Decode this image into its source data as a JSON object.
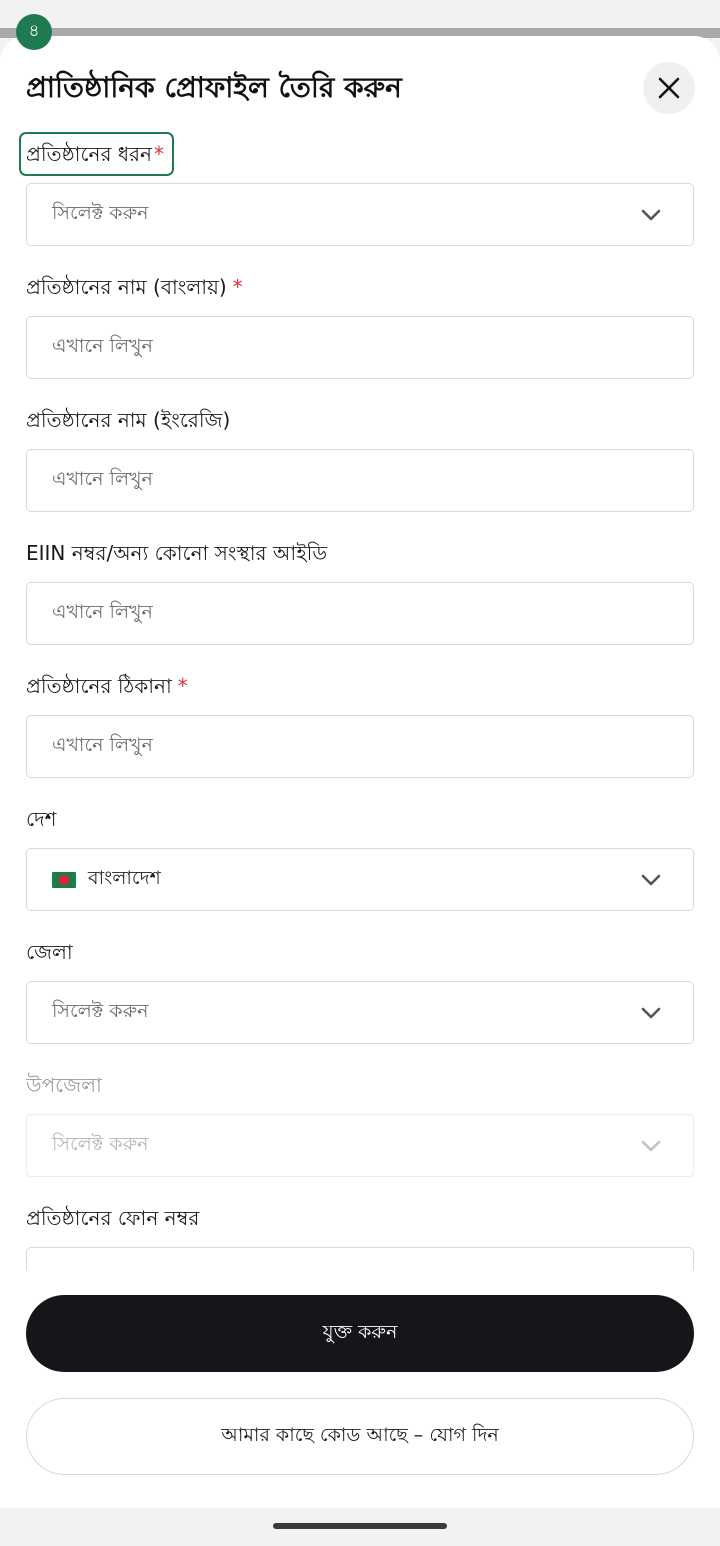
{
  "step_badge": "৪",
  "title": "প্রাতিষ্ঠানিক প্রোফাইল তৈরি করুন",
  "required_mark": "*",
  "fields": {
    "org_type": {
      "label": "প্রতিষ্ঠানের ধরন",
      "value": "সিলেক্ট করুন"
    },
    "name_bn": {
      "label": "প্রতিষ্ঠানের নাম (বাংলায়)",
      "placeholder": "এখানে লিখুন"
    },
    "name_en": {
      "label": "প্রতিষ্ঠানের নাম (ইংরেজি)",
      "placeholder": "এখানে লিখুন"
    },
    "eiin": {
      "label": "EIIN নম্বর/অন্য কোনো সংস্থার আইডি",
      "placeholder": "এখানে লিখুন"
    },
    "address": {
      "label": "প্রতিষ্ঠানের ঠিকানা",
      "placeholder": "এখানে লিখুন"
    },
    "country": {
      "label": "দেশ",
      "value": "বাংলাদেশ",
      "flag_icon": "bangladesh-flag-icon"
    },
    "district": {
      "label": "জেলা",
      "value": "সিলেক্ট করুন"
    },
    "upazila": {
      "label": "উপজেলা",
      "value": "সিলেক্ট করুন"
    },
    "phone": {
      "label": "প্রতিষ্ঠানের ফোন নম্বর"
    }
  },
  "buttons": {
    "add": "যুক্ত করুন",
    "have_code": "আমার কাছে কোড আছে – যোগ দিন"
  },
  "colors": {
    "accent_green": "#1e7b4f",
    "required_red": "#d9343a",
    "primary_button": "#141619"
  }
}
